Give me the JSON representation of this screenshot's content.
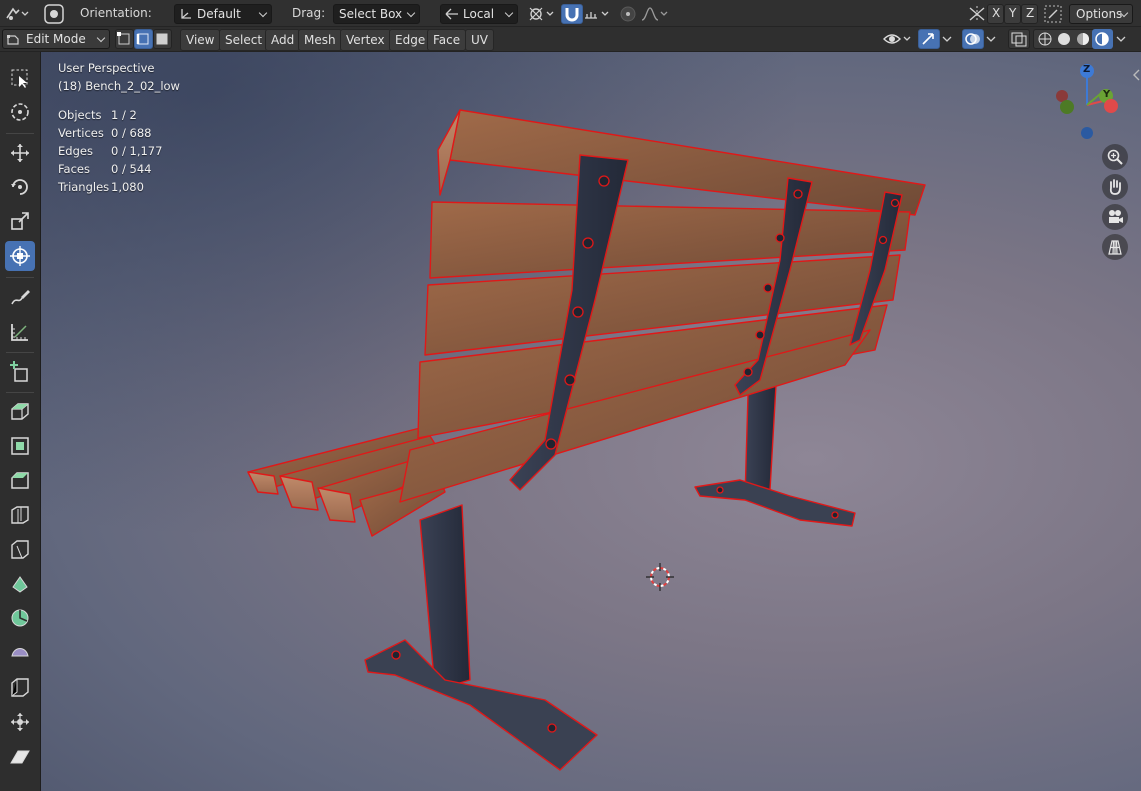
{
  "header": {
    "orientation_label": "Orientation:",
    "orientation_value": "Default",
    "drag_label": "Drag:",
    "drag_value": "Select Box",
    "pivot_value": "Local",
    "axis_x": "X",
    "axis_y": "Y",
    "axis_z": "Z",
    "options_label": "Options"
  },
  "edit_bar": {
    "mode_value": "Edit Mode",
    "menus": [
      "View",
      "Select",
      "Add",
      "Mesh",
      "Vertex",
      "Edge",
      "Face",
      "UV"
    ]
  },
  "viewport": {
    "perspective_label": "User Perspective",
    "object_name": "(18) Bench_2_02_low",
    "stats": [
      {
        "label": "Objects",
        "value": "1 / 2"
      },
      {
        "label": "Vertices",
        "value": "0 / 688"
      },
      {
        "label": "Edges",
        "value": "0 / 1,177"
      },
      {
        "label": "Faces",
        "value": "0 / 544"
      },
      {
        "label": "Triangles",
        "value": "1,080"
      }
    ],
    "gizmo": {
      "z": "Z",
      "y": "Y"
    }
  },
  "colors": {
    "accent": "#4772b3",
    "edge_highlight": "#e01818",
    "axis_x": "#e04a4a",
    "axis_y": "#6aa334",
    "axis_z": "#3d7ad6",
    "wood": "#9a6545",
    "steel": "#2c3242"
  },
  "tools": [
    "select-box-icon",
    "cursor-icon",
    "move-icon",
    "rotate-icon",
    "scale-icon",
    "transform-icon",
    "annotate-icon",
    "measure-icon",
    "add-cube-icon",
    "extrude-icon",
    "inset-icon",
    "bevel-icon",
    "loop-cut-icon",
    "knife-icon",
    "poly-build-icon",
    "spin-icon",
    "smooth-icon",
    "edge-slide-icon",
    "shrink-fatten-icon",
    "shear-icon"
  ]
}
